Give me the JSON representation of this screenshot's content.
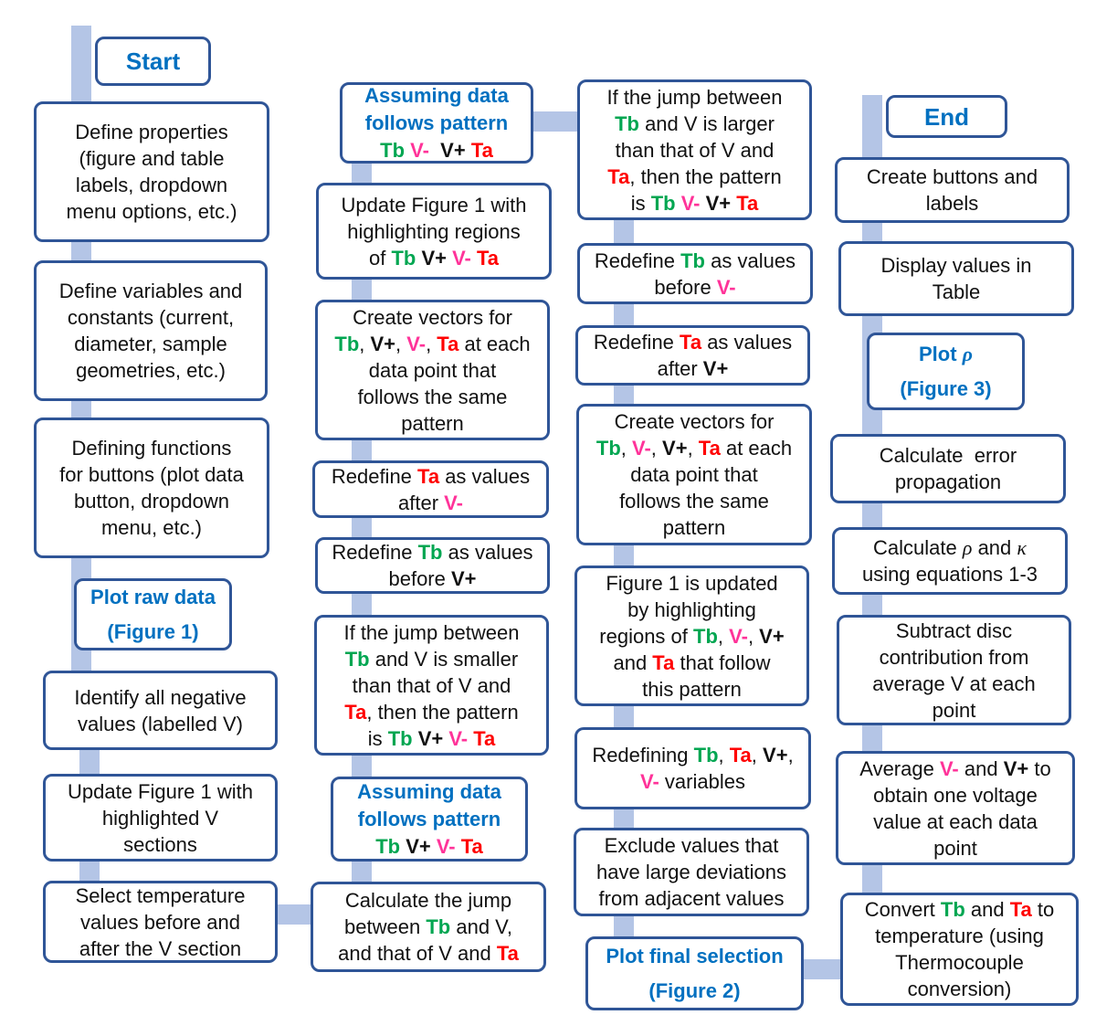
{
  "colors": {
    "border": "#2f5597",
    "connector": "#b4c5e6",
    "title_text": "#0070c0",
    "Tb": "#00a651",
    "V-": "#ff3399",
    "Ta": "#ff0000"
  },
  "boxes": {
    "start": {
      "lines": [
        [
          {
            "t": "Start"
          }
        ]
      ]
    },
    "props": {
      "lines": [
        [
          {
            "t": "Define properties"
          }
        ],
        [
          {
            "t": "(figure and table"
          }
        ],
        [
          {
            "t": "labels, dropdown"
          }
        ],
        [
          {
            "t": "menu options, etc.)"
          }
        ]
      ]
    },
    "vars": {
      "lines": [
        [
          {
            "t": "Define variables and"
          }
        ],
        [
          {
            "t": "constants (current,"
          }
        ],
        [
          {
            "t": "diameter, sample"
          }
        ],
        [
          {
            "t": "geometries, etc.)"
          }
        ]
      ]
    },
    "funcs": {
      "lines": [
        [
          {
            "t": "Defining functions"
          }
        ],
        [
          {
            "t": "for buttons (plot data"
          }
        ],
        [
          {
            "t": "button, dropdown"
          }
        ],
        [
          {
            "t": "menu, etc.)"
          }
        ]
      ]
    },
    "plotraw": {
      "lines": [
        [
          {
            "t": "Plot raw data"
          }
        ],
        [
          {
            "t": "(Figure 1)"
          }
        ]
      ]
    },
    "identify": {
      "lines": [
        [
          {
            "t": "Identify all negative"
          }
        ],
        [
          {
            "t": "values (labelled V)"
          }
        ]
      ]
    },
    "updatev": {
      "lines": [
        [
          {
            "t": "Update Figure 1 with"
          }
        ],
        [
          {
            "t": "highlighted V"
          }
        ],
        [
          {
            "t": "sections"
          }
        ]
      ]
    },
    "select": {
      "lines": [
        [
          {
            "t": "Select temperature"
          }
        ],
        [
          {
            "t": "values before and"
          }
        ],
        [
          {
            "t": "after the V section"
          }
        ]
      ]
    },
    "assume1": {
      "lines": [
        [
          {
            "t": "Assuming data"
          }
        ],
        [
          {
            "t": "follows pattern"
          }
        ],
        [
          {
            "t": "Tb",
            "s": "g"
          },
          {
            "t": " "
          },
          {
            "t": "V-",
            "s": "p"
          },
          {
            "t": "  V+ ",
            "s": "b"
          },
          {
            "t": "Ta",
            "s": "r"
          }
        ]
      ]
    },
    "upd2": {
      "lines": [
        [
          {
            "t": "Update Figure 1 with"
          }
        ],
        [
          {
            "t": "highlighting regions"
          }
        ],
        [
          {
            "t": "of "
          },
          {
            "t": "Tb",
            "s": "g"
          },
          {
            "t": " V+",
            "s": "b"
          },
          {
            "t": " V-",
            "s": "p"
          },
          {
            "t": " Ta",
            "s": "r"
          }
        ]
      ]
    },
    "vec1": {
      "lines": [
        [
          {
            "t": "Create vectors for"
          }
        ],
        [
          {
            "t": "Tb",
            "s": "g"
          },
          {
            "t": ", "
          },
          {
            "t": "V+",
            "s": "b"
          },
          {
            "t": ", "
          },
          {
            "t": "V-",
            "s": "p"
          },
          {
            "t": ", "
          },
          {
            "t": "Ta",
            "s": "r"
          },
          {
            "t": " at each"
          }
        ],
        [
          {
            "t": "data point that"
          }
        ],
        [
          {
            "t": "follows the same"
          }
        ],
        [
          {
            "t": "pattern"
          }
        ]
      ]
    },
    "redta1": {
      "lines": [
        [
          {
            "t": "Redefine "
          },
          {
            "t": "Ta",
            "s": "r"
          },
          {
            "t": " as values"
          }
        ],
        [
          {
            "t": "after "
          },
          {
            "t": "V-",
            "s": "p"
          }
        ]
      ]
    },
    "redtb1": {
      "lines": [
        [
          {
            "t": "Redefine "
          },
          {
            "t": "Tb",
            "s": "g"
          },
          {
            "t": " as values"
          }
        ],
        [
          {
            "t": "before "
          },
          {
            "t": "V+",
            "s": "b"
          }
        ]
      ]
    },
    "smaller": {
      "lines": [
        [
          {
            "t": "If the jump between"
          }
        ],
        [
          {
            "t": "Tb",
            "s": "g"
          },
          {
            "t": " and V is smaller"
          }
        ],
        [
          {
            "t": "than that of V and"
          }
        ],
        [
          {
            "t": "Ta",
            "s": "r"
          },
          {
            "t": ", then the pattern"
          }
        ],
        [
          {
            "t": "is "
          },
          {
            "t": "Tb",
            "s": "g"
          },
          {
            "t": " V+",
            "s": "b"
          },
          {
            "t": " V-",
            "s": "p"
          },
          {
            "t": " Ta",
            "s": "r"
          }
        ]
      ]
    },
    "assume2": {
      "lines": [
        [
          {
            "t": "Assuming data"
          }
        ],
        [
          {
            "t": "follows pattern"
          }
        ],
        [
          {
            "t": "Tb",
            "s": "g"
          },
          {
            "t": " V+",
            "s": "b"
          },
          {
            "t": " V-",
            "s": "p"
          },
          {
            "t": " Ta",
            "s": "r"
          }
        ]
      ]
    },
    "calcjump": {
      "lines": [
        [
          {
            "t": "Calculate the jump"
          }
        ],
        [
          {
            "t": "between "
          },
          {
            "t": "Tb",
            "s": "g"
          },
          {
            "t": " and V,"
          }
        ],
        [
          {
            "t": "and that of V and "
          },
          {
            "t": "Ta",
            "s": "r"
          }
        ]
      ]
    },
    "larger": {
      "lines": [
        [
          {
            "t": "If the jump between"
          }
        ],
        [
          {
            "t": "Tb",
            "s": "g"
          },
          {
            "t": " and V is larger"
          }
        ],
        [
          {
            "t": "than that of V and"
          }
        ],
        [
          {
            "t": "Ta",
            "s": "r"
          },
          {
            "t": ", then the pattern"
          }
        ],
        [
          {
            "t": "is "
          },
          {
            "t": "Tb",
            "s": "g"
          },
          {
            "t": " V-",
            "s": "p"
          },
          {
            "t": " V+",
            "s": "b"
          },
          {
            "t": " Ta",
            "s": "r"
          }
        ]
      ]
    },
    "redtb2": {
      "lines": [
        [
          {
            "t": "Redefine "
          },
          {
            "t": "Tb",
            "s": "g"
          },
          {
            "t": " as values"
          }
        ],
        [
          {
            "t": "before "
          },
          {
            "t": "V-",
            "s": "p"
          }
        ]
      ]
    },
    "redta2": {
      "lines": [
        [
          {
            "t": "Redefine "
          },
          {
            "t": "Ta",
            "s": "r"
          },
          {
            "t": " as values"
          }
        ],
        [
          {
            "t": "after "
          },
          {
            "t": "V+",
            "s": "b"
          }
        ]
      ]
    },
    "vec2": {
      "lines": [
        [
          {
            "t": "Create vectors for"
          }
        ],
        [
          {
            "t": "Tb",
            "s": "g"
          },
          {
            "t": ", "
          },
          {
            "t": "V-",
            "s": "p"
          },
          {
            "t": ", "
          },
          {
            "t": "V+",
            "s": "b"
          },
          {
            "t": ", "
          },
          {
            "t": "Ta",
            "s": "r"
          },
          {
            "t": " at each"
          }
        ],
        [
          {
            "t": "data point that"
          }
        ],
        [
          {
            "t": "follows the same"
          }
        ],
        [
          {
            "t": "pattern"
          }
        ]
      ]
    },
    "fig1upd": {
      "lines": [
        [
          {
            "t": "Figure 1 is updated"
          }
        ],
        [
          {
            "t": "by highlighting"
          }
        ],
        [
          {
            "t": "regions of "
          },
          {
            "t": "Tb",
            "s": "g"
          },
          {
            "t": ", "
          },
          {
            "t": "V-",
            "s": "p"
          },
          {
            "t": ", "
          },
          {
            "t": "V+",
            "s": "b"
          }
        ],
        [
          {
            "t": "and "
          },
          {
            "t": "Ta",
            "s": "r"
          },
          {
            "t": " that follow"
          }
        ],
        [
          {
            "t": "this pattern"
          }
        ]
      ]
    },
    "redefining": {
      "lines": [
        [
          {
            "t": "Redefining "
          },
          {
            "t": "Tb",
            "s": "g"
          },
          {
            "t": ", "
          },
          {
            "t": "Ta",
            "s": "r"
          },
          {
            "t": ", "
          },
          {
            "t": "V+",
            "s": "b"
          },
          {
            "t": ","
          }
        ],
        [
          {
            "t": "V-",
            "s": "p"
          },
          {
            "t": " variables"
          }
        ]
      ]
    },
    "exclude": {
      "lines": [
        [
          {
            "t": "Exclude values that"
          }
        ],
        [
          {
            "t": "have large deviations"
          }
        ],
        [
          {
            "t": "from adjacent values"
          }
        ]
      ]
    },
    "plotfinal": {
      "lines": [
        [
          {
            "t": "Plot final selection"
          }
        ],
        [
          {
            "t": "(Figure 2)"
          }
        ]
      ]
    },
    "end": {
      "lines": [
        [
          {
            "t": "End"
          }
        ]
      ]
    },
    "buttons": {
      "lines": [
        [
          {
            "t": "Create buttons and"
          }
        ],
        [
          {
            "t": "labels"
          }
        ]
      ]
    },
    "display": {
      "lines": [
        [
          {
            "t": "Display values in"
          }
        ],
        [
          {
            "t": "Table"
          }
        ]
      ]
    },
    "plotrho": {
      "lines": [
        [
          {
            "t": "Plot "
          },
          {
            "t": "ρ",
            "s": "i"
          }
        ],
        [
          {
            "t": "(Figure 3)"
          }
        ]
      ]
    },
    "error": {
      "lines": [
        [
          {
            "t": "Calculate  error"
          }
        ],
        [
          {
            "t": "propagation"
          }
        ]
      ]
    },
    "rhokappa": {
      "lines": [
        [
          {
            "t": "Calculate "
          },
          {
            "t": "ρ",
            "s": "i"
          },
          {
            "t": " and "
          },
          {
            "t": "κ",
            "s": "i"
          }
        ],
        [
          {
            "t": "using equations 1-3"
          }
        ]
      ]
    },
    "subtract": {
      "lines": [
        [
          {
            "t": "Subtract disc"
          }
        ],
        [
          {
            "t": "contribution from"
          }
        ],
        [
          {
            "t": "average V at each"
          }
        ],
        [
          {
            "t": "point"
          }
        ]
      ]
    },
    "average": {
      "lines": [
        [
          {
            "t": "Average "
          },
          {
            "t": "V-",
            "s": "p"
          },
          {
            "t": " and "
          },
          {
            "t": "V+",
            "s": "b"
          },
          {
            "t": " to"
          }
        ],
        [
          {
            "t": "obtain one voltage"
          }
        ],
        [
          {
            "t": "value at each data"
          }
        ],
        [
          {
            "t": "point"
          }
        ]
      ]
    },
    "convert": {
      "lines": [
        [
          {
            "t": "Convert "
          },
          {
            "t": "Tb",
            "s": "g"
          },
          {
            "t": " and "
          },
          {
            "t": "Ta",
            "s": "r"
          },
          {
            "t": " to"
          }
        ],
        [
          {
            "t": "temperature (using"
          }
        ],
        [
          {
            "t": "Thermocouple"
          }
        ],
        [
          {
            "t": "conversion)"
          }
        ]
      ]
    }
  }
}
